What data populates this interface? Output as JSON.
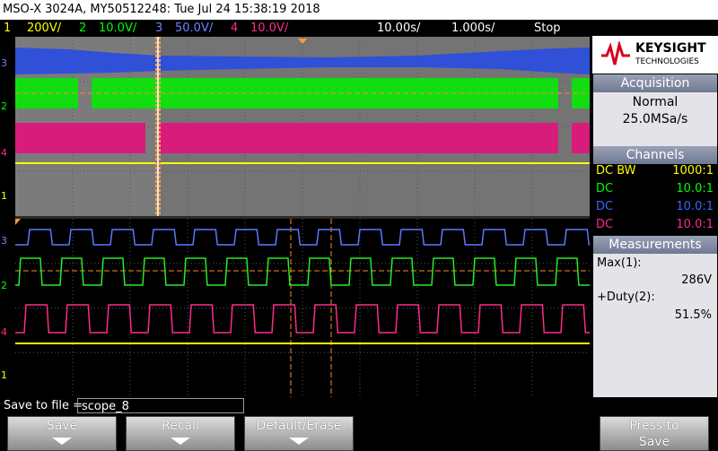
{
  "title": "MSO-X 3024A, MY50512248: Tue Jul 24 15:38:19 2018",
  "status": {
    "ch1": {
      "num": "1",
      "scale": "200V/"
    },
    "ch2": {
      "num": "2",
      "scale": "10.0V/"
    },
    "ch3": {
      "num": "3",
      "scale": "50.0V/"
    },
    "ch4": {
      "num": "4",
      "scale": "10.0V/"
    },
    "timebase": "10.00s/",
    "delay": "1.000s/",
    "run_state": "Stop",
    "trigger_symbol": "⨍",
    "trigger_source": "L"
  },
  "logo": {
    "brand": "KEYSIGHT",
    "sub": "TECHNOLOGIES"
  },
  "acquisition": {
    "header": "Acquisition",
    "mode": "Normal",
    "rate": "25.0MSa/s"
  },
  "channels": {
    "header": "Channels",
    "rows": [
      {
        "coupling": "DC BW",
        "probe": "1000:1",
        "color": "#ffff00"
      },
      {
        "coupling": "DC",
        "probe": "10.0:1",
        "color": "#00ff00"
      },
      {
        "coupling": "DC",
        "probe": "10.0:1",
        "color": "#3c64ff"
      },
      {
        "coupling": "DC",
        "probe": "10.0:1",
        "color": "#ff2a8a"
      }
    ]
  },
  "measurements": {
    "header": "Measurements",
    "m1_label": "Max(1):",
    "m1_value": "286V",
    "m2_label": "+Duty(2):",
    "m2_value": "51.5%"
  },
  "save": {
    "label": "Save to file =",
    "filename": "scope_8"
  },
  "softkeys": [
    "Save",
    "Recall",
    "Default/Erase",
    "Press to Save"
  ],
  "colors": {
    "ch1": "#ffff00",
    "ch2": "#00ff00",
    "ch3": "#4a6cff",
    "ch4": "#ff2a8a",
    "grid": "#555555"
  }
}
